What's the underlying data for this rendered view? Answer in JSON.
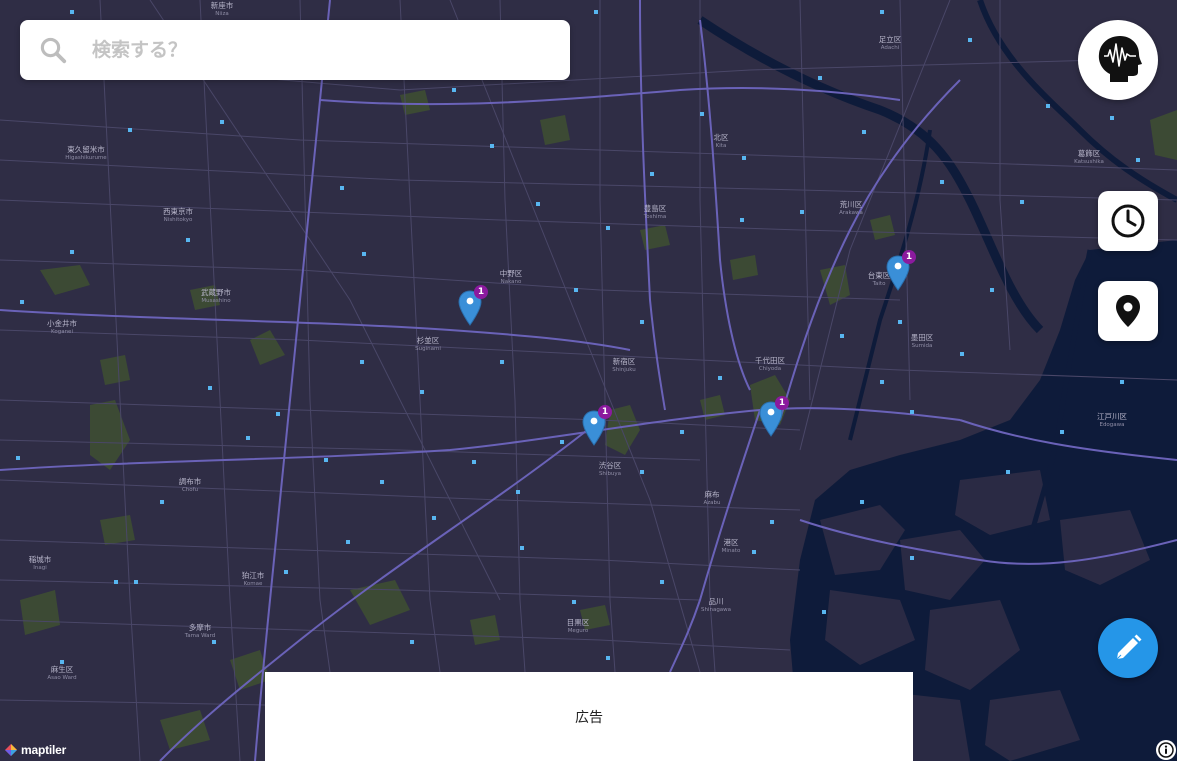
{
  "search": {
    "placeholder": "検索する？"
  },
  "ad": {
    "label": "広告"
  },
  "attribution": {
    "logo_text": "maptiler"
  },
  "colors": {
    "map_land": "#2f2d45",
    "water": "#0e1b3a",
    "park": "#3c4a34",
    "major_road": "#6a62b8",
    "minor_road": "#4a4768",
    "edit_button": "#2596e8",
    "marker": "#3a8fd8",
    "marker_badge": "#8b1a9e"
  },
  "icons": {
    "search": "search-icon",
    "avatar": "head-soundwave-icon",
    "history": "clock-icon",
    "location": "map-pin-icon",
    "edit": "pencil-icon",
    "info": "info-icon"
  },
  "map_labels": [
    {
      "name": "足立区",
      "sub": "Adachi"
    },
    {
      "name": "北区",
      "sub": "Kita"
    },
    {
      "name": "荒川区",
      "sub": "Arakawa"
    },
    {
      "name": "葛飾区",
      "sub": "Katsushika"
    },
    {
      "name": "東久留米市",
      "sub": "Higashikurume"
    },
    {
      "name": "西東京市",
      "sub": "Nishitokyo"
    },
    {
      "name": "豊島区",
      "sub": "Toshima"
    },
    {
      "name": "中野区",
      "sub": "Nakano"
    },
    {
      "name": "台東区",
      "sub": "Taito"
    },
    {
      "name": "武蔵野市",
      "sub": "Musashino"
    },
    {
      "name": "小金井市",
      "sub": "Koganei"
    },
    {
      "name": "杉並区",
      "sub": "Suginami"
    },
    {
      "name": "新宿区",
      "sub": "Shinjuku"
    },
    {
      "name": "千代田区",
      "sub": "Chiyoda"
    },
    {
      "name": "墨田区",
      "sub": "Sumida"
    },
    {
      "name": "江戸川区",
      "sub": "Edogawa"
    },
    {
      "name": "渋谷区",
      "sub": "Shibuya"
    },
    {
      "name": "調布市",
      "sub": "Chofu"
    },
    {
      "name": "麻布",
      "sub": "Azabu"
    },
    {
      "name": "港区",
      "sub": "Minato"
    },
    {
      "name": "稲城市",
      "sub": "Inagi"
    },
    {
      "name": "狛江市",
      "sub": "Komae"
    },
    {
      "name": "品川",
      "sub": "Shinagawa"
    },
    {
      "name": "多摩市",
      "sub": "Tama Ward"
    },
    {
      "name": "目黒区",
      "sub": "Meguro"
    },
    {
      "name": "麻生区",
      "sub": "Asao Ward"
    },
    {
      "name": "新座市",
      "sub": "Niiza"
    }
  ],
  "markers": [
    {
      "count": "1"
    },
    {
      "count": "1"
    },
    {
      "count": "1"
    },
    {
      "count": "1"
    }
  ]
}
